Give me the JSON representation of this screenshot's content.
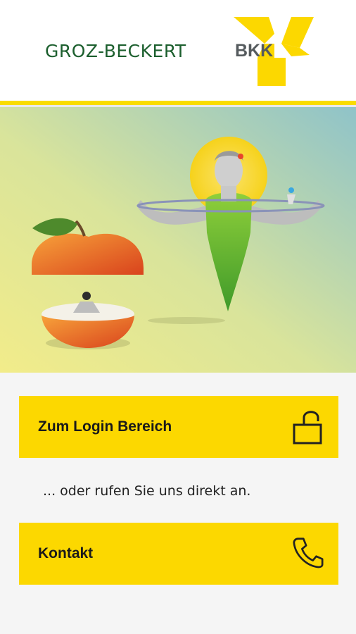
{
  "header": {
    "brand_name": "GROZ-BECKERT",
    "brand_suffix": "BKK"
  },
  "colors": {
    "accent_yellow": "#fcd800",
    "brand_green": "#1c5f2e",
    "background": "#f5f5f5"
  },
  "hero": {
    "icons": [
      "apple-icon",
      "athlete-woman-icon",
      "hoop-icon"
    ]
  },
  "login_button": {
    "label": "Zum Login Bereich",
    "icon": "unlock-icon"
  },
  "hint_text": "... oder rufen Sie uns direkt an.",
  "contact_button": {
    "label": "Kontakt",
    "icon": "phone-icon"
  }
}
